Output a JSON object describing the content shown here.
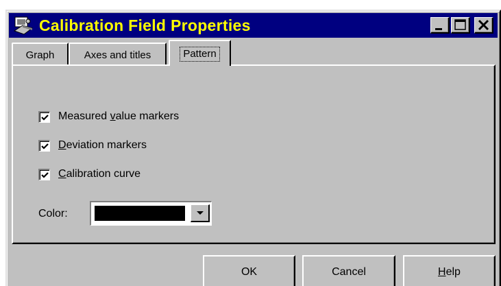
{
  "window": {
    "title": "Calibration Field Properties",
    "title_color": "#ffff00",
    "titlebar_color": "#000080",
    "face_color": "#c0c0c0"
  },
  "tabs": [
    {
      "label": "Graph",
      "active": false
    },
    {
      "label": "Axes and titles",
      "active": false
    },
    {
      "label": "Pattern",
      "active": true
    }
  ],
  "options": {
    "measured": {
      "label_pre": "Measured ",
      "label_u": "v",
      "label_post": "alue markers",
      "checked": true
    },
    "deviation": {
      "label_pre": "",
      "label_u": "D",
      "label_post": "eviation markers",
      "checked": true
    },
    "curve": {
      "label_pre": "",
      "label_u": "C",
      "label_post": "alibration curve",
      "checked": true
    }
  },
  "color": {
    "label": "Color:",
    "selected_color": "#000000"
  },
  "buttons": {
    "ok": "OK",
    "cancel": "Cancel",
    "help_u": "H",
    "help_rest": "elp"
  }
}
